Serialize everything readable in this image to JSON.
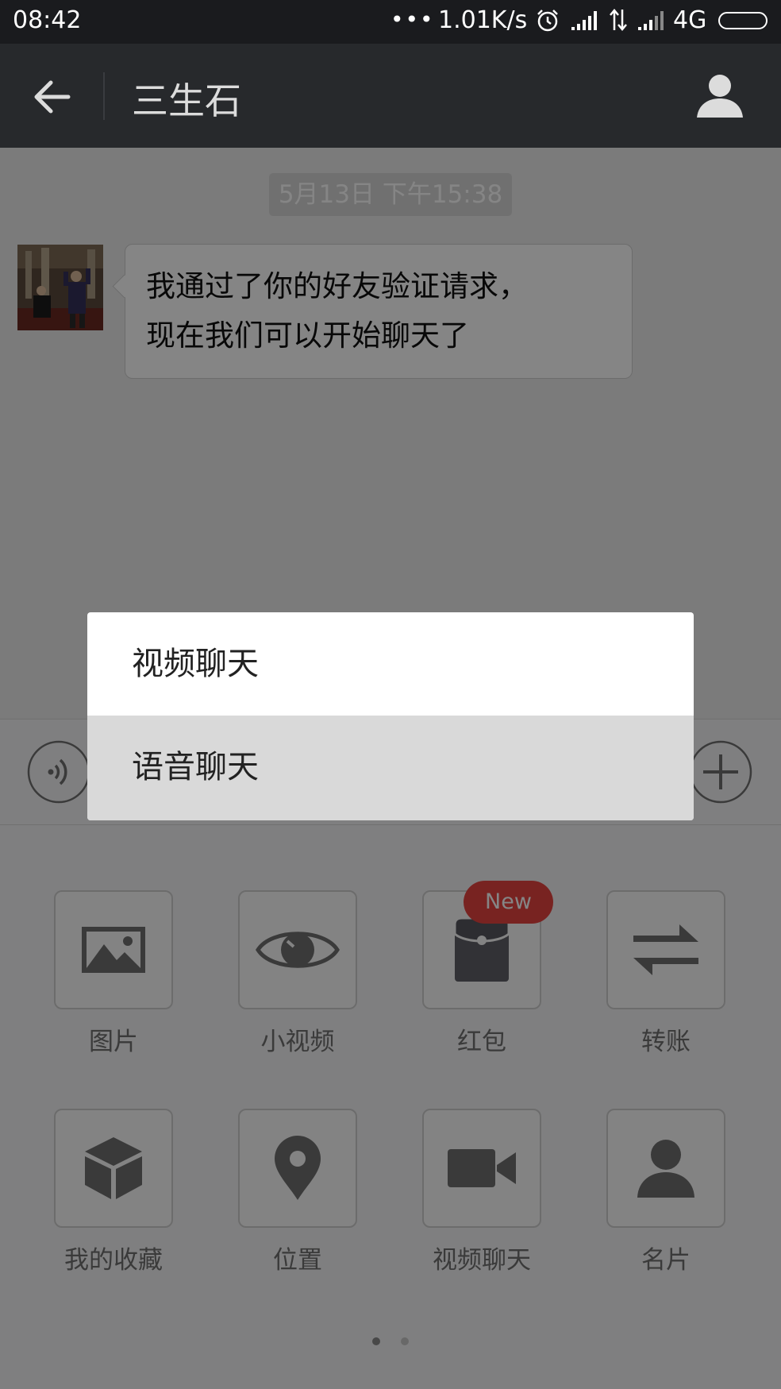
{
  "status_bar": {
    "time": "08:42",
    "dots": "•••",
    "speed": "1.01K/s",
    "network": "4G",
    "icons": [
      "alarm-icon",
      "signal-icon",
      "data-arrows-icon",
      "signal-icon",
      "battery-icon"
    ]
  },
  "header": {
    "title": "三生石",
    "back_icon": "arrow-left-icon",
    "profile_icon": "person-icon"
  },
  "chat": {
    "timestamp": "5月13日 下午15:38",
    "messages": [
      {
        "sender": "contact",
        "lines": [
          "我通过了你的好友验证请求，",
          "现在我们可以开始聊天了"
        ]
      }
    ]
  },
  "input_bar": {
    "voice_icon": "voice-icon",
    "plus_icon": "plus-icon"
  },
  "panel": {
    "items": [
      {
        "label": "图片",
        "icon": "image-icon"
      },
      {
        "label": "小视频",
        "icon": "eye-icon"
      },
      {
        "label": "红包",
        "icon": "red-packet-icon",
        "badge": "New"
      },
      {
        "label": "转账",
        "icon": "transfer-icon"
      },
      {
        "label": "我的收藏",
        "icon": "cube-icon"
      },
      {
        "label": "位置",
        "icon": "location-pin-icon"
      },
      {
        "label": "视频聊天",
        "icon": "video-camera-icon"
      },
      {
        "label": "名片",
        "icon": "person-icon"
      }
    ],
    "pages": 2,
    "current_page": 1
  },
  "popup_menu": {
    "items": [
      "视频聊天",
      "语音聊天"
    ],
    "pressed_index": 1
  },
  "colors": {
    "status_bar_bg": "#1a1b1e",
    "title_bar_bg": "#27292c",
    "badge_red": "#e64440",
    "overlay": "rgba(0,0,0,0.48)"
  }
}
